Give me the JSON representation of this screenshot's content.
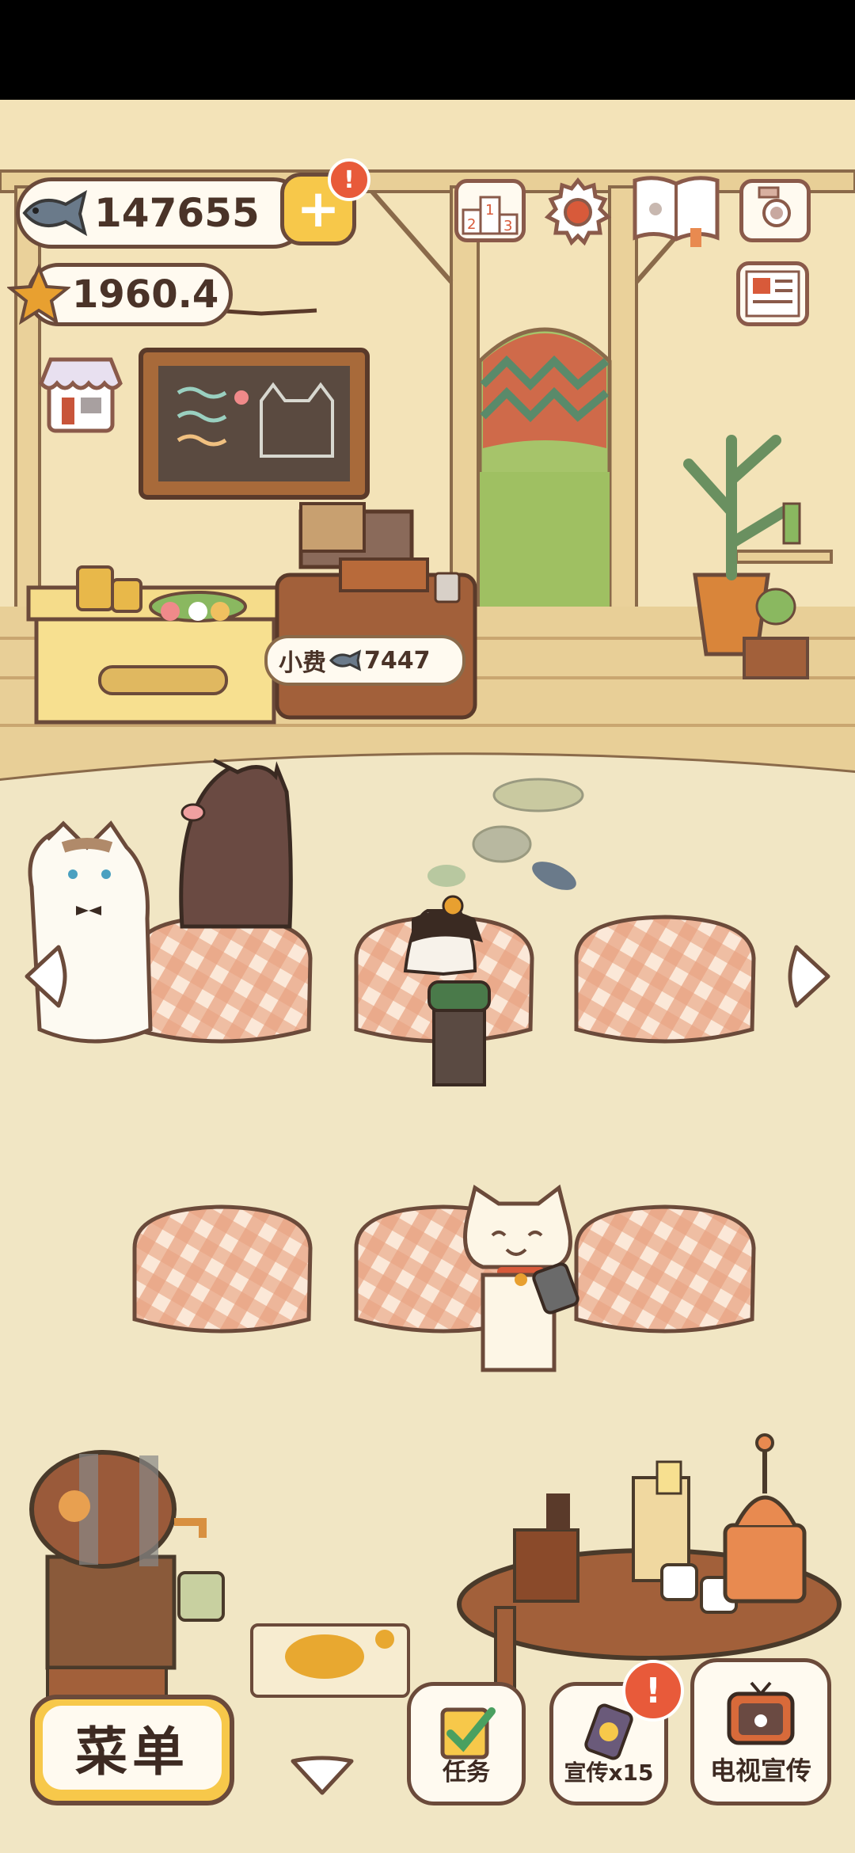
{
  "currency": {
    "fish": "147655",
    "stars": "1960.4"
  },
  "tip_bubble": {
    "label": "小费",
    "amount": "7447"
  },
  "bottom_bar": {
    "menu_label": "菜单",
    "tasks_label": "任务",
    "promote_label": "宣传x15",
    "tv_label": "电视宣传"
  },
  "icons": {
    "fish": "fish-icon",
    "star": "star-icon",
    "add": "plus-icon",
    "ranking": "podium-icon",
    "settings": "gear-icon",
    "book": "paw-book-icon",
    "camera": "camera-icon",
    "news": "newspaper-icon",
    "shop": "shop-icon",
    "alert": "exclamation-icon"
  },
  "colors": {
    "wall": "#f3e3b8",
    "floor": "#f1e6c4",
    "wood": "#c99a55",
    "outline": "#6b4a3a",
    "tablecloth": "#e8a280",
    "alert": "#e85a3a",
    "accent_yellow": "#f7c84a"
  }
}
